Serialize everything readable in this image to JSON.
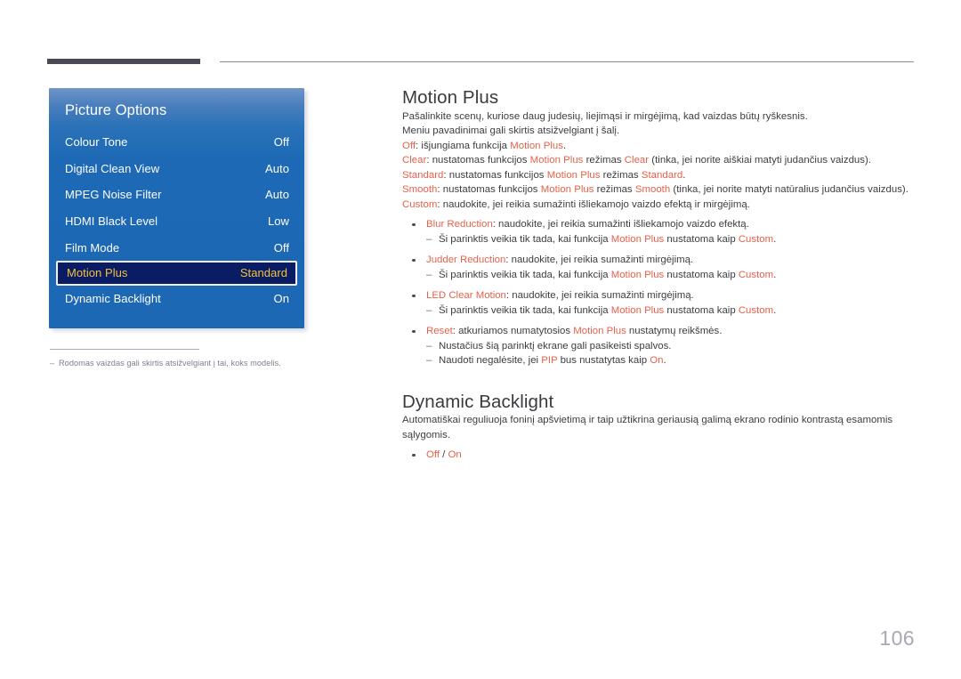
{
  "page": {
    "number": "106"
  },
  "osd": {
    "title": "Picture Options",
    "rows": [
      {
        "label": "Colour Tone",
        "value": "Off",
        "selected": false
      },
      {
        "label": "Digital Clean View",
        "value": "Auto",
        "selected": false
      },
      {
        "label": "MPEG Noise Filter",
        "value": "Auto",
        "selected": false
      },
      {
        "label": "HDMI Black Level",
        "value": "Low",
        "selected": false
      },
      {
        "label": "Film Mode",
        "value": "Off",
        "selected": false
      },
      {
        "label": "Motion Plus",
        "value": "Standard",
        "selected": true
      },
      {
        "label": "Dynamic Backlight",
        "value": "On",
        "selected": false
      }
    ],
    "footnote": {
      "dash": "‒",
      "text": "Rodomas vaizdas gali skirtis atsižvelgiant į tai, koks modelis."
    },
    "colors": {
      "panel_blue": "#1c68b4",
      "panel_blue_top": "#6f95c6",
      "selected_bg": "#0a1c63",
      "selected_text": "#f5c13a",
      "selected_border": "#f2f0f4"
    }
  },
  "theme": {
    "accent": "#e8604a",
    "body_text": "#3d3d42",
    "heading": "#3a3a3f",
    "rule_dark": "#4a4a57",
    "rule_thin": "#8c8c92",
    "page_number": "#a8a9b4"
  },
  "sections": [
    {
      "id": "motion-plus",
      "title": "Motion Plus",
      "intro": [
        "Pašalinkite scenų, kuriose daug judesių, liejimąsi ir mirgėjimą, kad vaizdas būtų ryškesnis.",
        "Meniu pavadinimai gali skirtis atsižvelgiant į šalį."
      ],
      "definitions": [
        {
          "term": "Off",
          "rest_1": ": išjungiama funkcija ",
          "ref_1": "Motion Plus",
          "rest_2": ".",
          "ref_2": "",
          "rest_3": ""
        },
        {
          "term": "Clear",
          "rest_1": ": nustatomas funkcijos ",
          "ref_1": "Motion Plus",
          "rest_2": " režimas ",
          "ref_2": "Clear",
          "rest_3": " (tinka, jei norite aiškiai matyti judančius vaizdus)."
        },
        {
          "term": "Standard",
          "rest_1": ": nustatomas funkcijos ",
          "ref_1": "Motion Plus",
          "rest_2": " režimas ",
          "ref_2": "Standard",
          "rest_3": "."
        },
        {
          "term": "Smooth",
          "rest_1": ": nustatomas funkcijos ",
          "ref_1": "Motion Plus",
          "rest_2": " režimas ",
          "ref_2": "Smooth",
          "rest_3": " (tinka, jei norite matyti natūralius judančius vaizdus)."
        },
        {
          "term": "Custom",
          "rest_1": ": naudokite, jei reikia sumažinti išliekamojo vaizdo efektą ir mirgėjimą.",
          "ref_1": "",
          "rest_2": "",
          "ref_2": "",
          "rest_3": ""
        }
      ],
      "bullets": [
        {
          "term": "Blur Reduction",
          "text": ": naudokite, jei reikia sumažinti išliekamojo vaizdo efektą.",
          "subs": [
            {
              "pre": "Ši parinktis veikia tik tada, kai funkcija ",
              "ref": "Motion Plus",
              "mid": " nustatoma kaip ",
              "ref2": "Custom",
              "post": "."
            }
          ]
        },
        {
          "term": "Judder Reduction",
          "text": ": naudokite, jei reikia sumažinti mirgėjimą.",
          "subs": [
            {
              "pre": "Ši parinktis veikia tik tada, kai funkcija ",
              "ref": "Motion Plus",
              "mid": " nustatoma kaip ",
              "ref2": "Custom",
              "post": "."
            }
          ]
        },
        {
          "term": "LED Clear Motion",
          "text": ": naudokite, jei reikia sumažinti mirgėjimą.",
          "subs": [
            {
              "pre": "Ši parinktis veikia tik tada, kai funkcija ",
              "ref": "Motion Plus",
              "mid": " nustatoma kaip ",
              "ref2": "Custom",
              "post": "."
            }
          ]
        },
        {
          "term": "Reset",
          "text_pre": ": atkuriamos numatytosios ",
          "ref": "Motion Plus",
          "text_post": " nustatymų reikšmės.",
          "subs": [
            {
              "pre": "Nustačius šią parinktį ekrane gali pasikeisti spalvos.",
              "ref": "",
              "mid": "",
              "ref2": "",
              "post": ""
            },
            {
              "pre": "Naudoti negalėsite, jei ",
              "ref": "PIP",
              "mid": " bus nustatytas kaip ",
              "ref2": "On",
              "post": "."
            }
          ]
        }
      ]
    },
    {
      "id": "dynamic-backlight",
      "title": "Dynamic Backlight",
      "paragraph": "Automatiškai reguliuoja foninį apšvietimą ir taip užtikrina geriausią galimą ekrano rodinio kontrastą esamomis sąlygomis.",
      "options": {
        "left": "Off",
        "sep": " / ",
        "right": "On"
      }
    }
  ]
}
